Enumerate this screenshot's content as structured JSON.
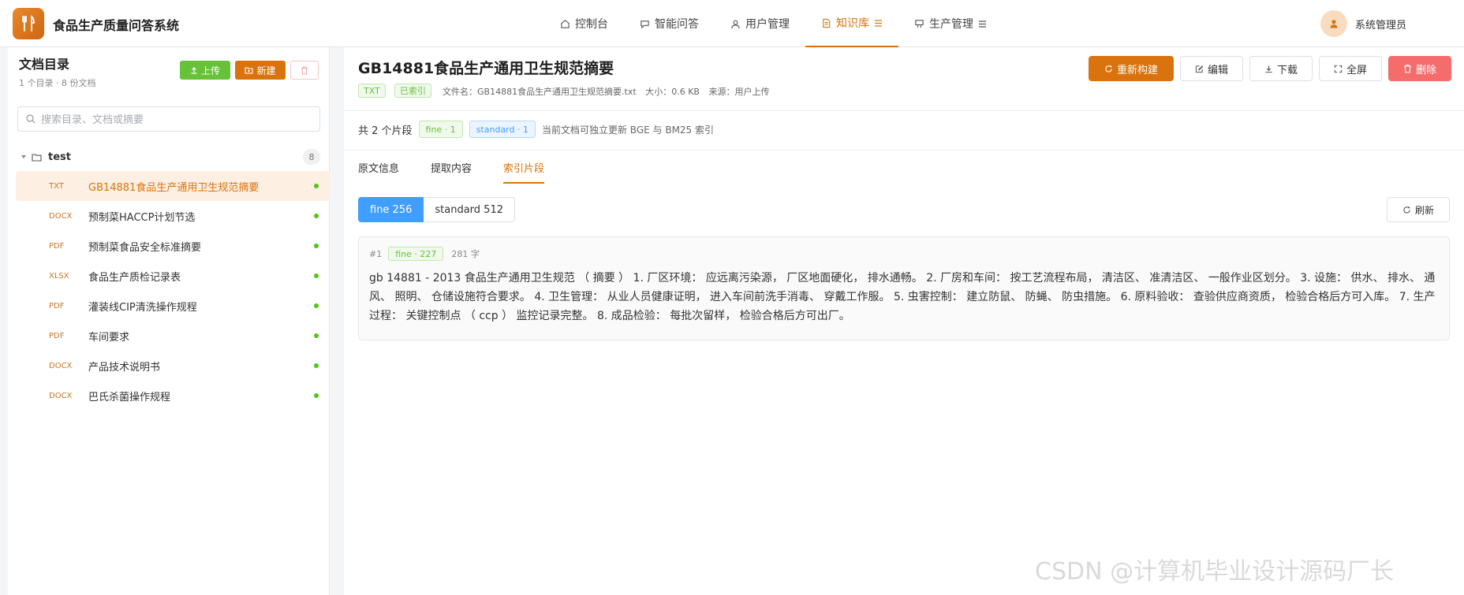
{
  "app": {
    "title": "食品生产质量问答系统",
    "accent_color": "#d9730d"
  },
  "nav": {
    "items": [
      {
        "label": "控制台",
        "icon": "home-icon"
      },
      {
        "label": "智能问答",
        "icon": "chat-icon"
      },
      {
        "label": "用户管理",
        "icon": "user-icon"
      },
      {
        "label": "知识库",
        "icon": "document-icon",
        "active": true
      },
      {
        "label": "生产管理",
        "icon": "factory-icon"
      }
    ]
  },
  "user": {
    "name": "系统管理员"
  },
  "sidebar": {
    "title": "文档目录",
    "subtitle": "1 个目录 · 8 份文档",
    "upload_label": "上传",
    "new_label": "新建",
    "search_placeholder": "搜索目录、文档或摘要",
    "folder": {
      "name": "test",
      "count": "8"
    },
    "documents": [
      {
        "type": "TXT",
        "name": "GB14881食品生产通用卫生规范摘要",
        "active": true
      },
      {
        "type": "DOCX",
        "name": "预制菜HACCP计划节选"
      },
      {
        "type": "PDF",
        "name": "预制菜食品安全标准摘要"
      },
      {
        "type": "XLSX",
        "name": "食品生产质检记录表"
      },
      {
        "type": "PDF",
        "name": "灌装线CIP清洗操作规程"
      },
      {
        "type": "PDF",
        "name": "车间要求"
      },
      {
        "type": "DOCX",
        "name": "产品技术说明书"
      },
      {
        "type": "DOCX",
        "name": "巴氏杀菌操作规程"
      }
    ]
  },
  "document": {
    "title": "GB14881食品生产通用卫生规范摘要",
    "type_tag": "TXT",
    "status_tag": "已索引",
    "file_name": "文件名：GB14881食品生产通用卫生规范摘要.txt",
    "size": "大小：0.6 KB",
    "source": "来源：用户上传",
    "actions": {
      "rebuild": "重新构建",
      "edit": "编辑",
      "download": "下载",
      "fullscreen": "全屏",
      "delete": "删除"
    }
  },
  "segments": {
    "summary": "共 2 个片段",
    "fine_pill": "fine · 1",
    "standard_pill": "standard · 1",
    "note": "当前文档可独立更新 BGE 与 BM25 索引"
  },
  "tabs": [
    {
      "label": "原文信息"
    },
    {
      "label": "提取内容"
    },
    {
      "label": "索引片段",
      "active": true
    }
  ],
  "segment_switch": {
    "fine": "fine 256",
    "standard": "standard 512",
    "refresh": "刷新"
  },
  "chunk": {
    "index": "#1",
    "tag": "fine · 227",
    "chars": "281 字",
    "text": "gb 14881 - 2013 食品生产通用卫生规范 （ 摘要 ） 1. 厂区环境： 应远离污染源， 厂区地面硬化， 排水通畅。 2. 厂房和车间： 按工艺流程布局， 清洁区、 准清洁区、 一般作业区划分。 3. 设施： 供水、 排水、 通风、 照明、 仓储设施符合要求。 4. 卫生管理： 从业人员健康证明， 进入车间前洗手消毒、 穿戴工作服。 5. 虫害控制： 建立防鼠、 防蝇、 防虫措施。 6. 原料验收： 查验供应商资质， 检验合格后方可入库。 7. 生产过程： 关键控制点 （ ccp ） 监控记录完整。 8. 成品检验： 每批次留样， 检验合格后方可出厂。"
  },
  "watermark": "CSDN @计算机毕业设计源码厂长"
}
